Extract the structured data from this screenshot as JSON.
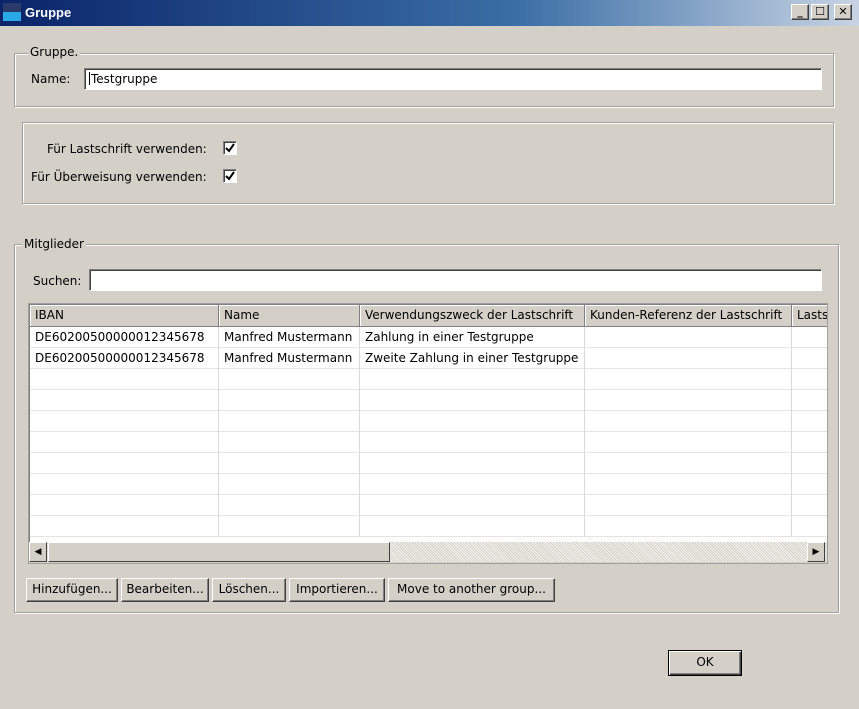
{
  "window": {
    "title": "Gruppe",
    "minimize_label": "_",
    "maximize_label": "☐",
    "close_label": "✕"
  },
  "group_box": {
    "legend": "Gruppe.",
    "name_label": "Name:",
    "name_value": "Testgruppe"
  },
  "usage_box": {
    "direct_debit_label": "Für Lastschrift verwenden:",
    "direct_debit_checked": true,
    "transfer_label": "Für Überweisung verwenden:",
    "transfer_checked": true,
    "check_glyph": "✔"
  },
  "members": {
    "legend": "Mitglieder",
    "search_label": "Suchen:",
    "search_value": "",
    "columns": [
      "IBAN",
      "Name",
      "Verwendungszweck der Lastschrift",
      "Kunden-Referenz der Lastschrift",
      "Lastschrift"
    ],
    "rows": [
      [
        "DE60200500000012345678",
        "Manfred Mustermann",
        "Zahlung in einer Testgruppe",
        "",
        ""
      ],
      [
        "DE60200500000012345678",
        "Manfred Mustermann",
        "Zweite Zahlung in einer Testgruppe",
        "",
        ""
      ],
      [
        "",
        "",
        "",
        "",
        ""
      ],
      [
        "",
        "",
        "",
        "",
        ""
      ],
      [
        "",
        "",
        "",
        "",
        ""
      ],
      [
        "",
        "",
        "",
        "",
        ""
      ],
      [
        "",
        "",
        "",
        "",
        ""
      ],
      [
        "",
        "",
        "",
        "",
        ""
      ],
      [
        "",
        "",
        "",
        "",
        ""
      ],
      [
        "",
        "",
        "",
        "",
        ""
      ]
    ],
    "scroll_left_glyph": "◀",
    "scroll_right_glyph": "▶",
    "buttons": {
      "add": "Hinzufügen...",
      "edit": "Bearbeiten...",
      "delete": "Löschen...",
      "import": "Importieren...",
      "move": "Move to another group..."
    }
  },
  "ok_label": "OK"
}
